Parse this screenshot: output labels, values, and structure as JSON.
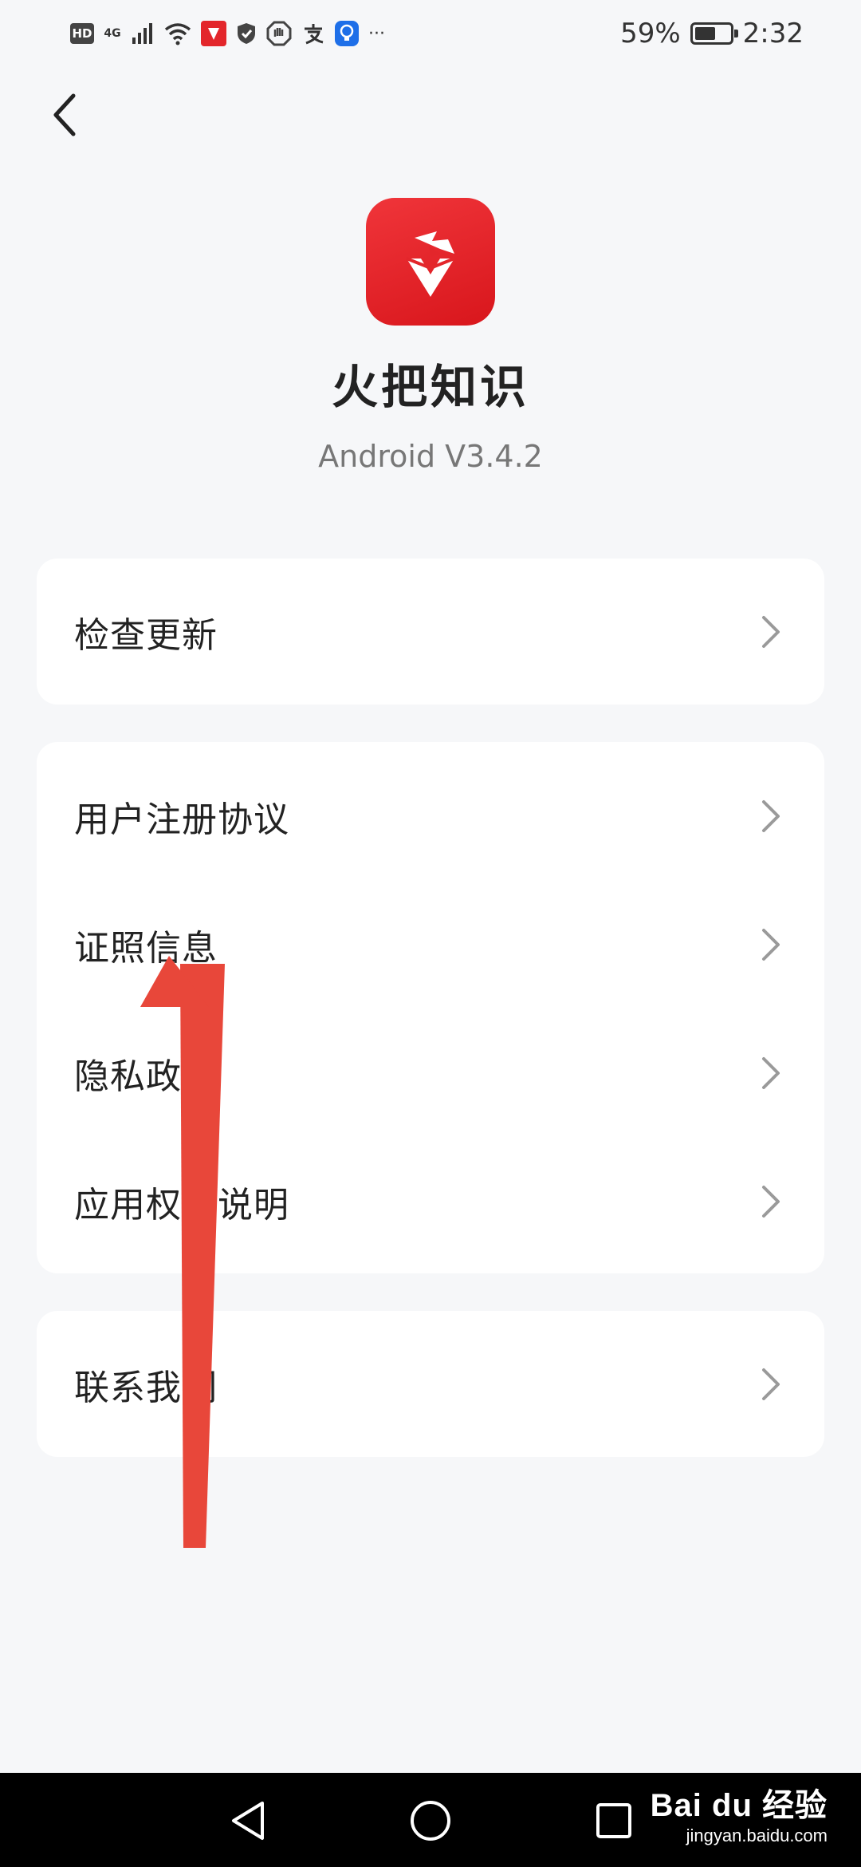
{
  "status_bar": {
    "hd_label": "HD",
    "network_label": "4G",
    "more_label": "···",
    "battery_percent_text": "59%",
    "battery_level": 0.59,
    "time": "2:32"
  },
  "app": {
    "name": "火把知识",
    "version": "Android V3.4.2",
    "brand_color": "#e3262b"
  },
  "menu": {
    "group1": [
      {
        "label": "检查更新"
      }
    ],
    "group2": [
      {
        "label": "用户注册协议"
      },
      {
        "label": "证照信息"
      },
      {
        "label": "隐私政策"
      },
      {
        "label": "应用权限说明"
      }
    ],
    "group3": [
      {
        "label": "联系我们"
      }
    ]
  },
  "annotation": {
    "arrow_color": "#e8473a"
  },
  "watermark": {
    "main": "Bai du 经验",
    "sub": "jingyan.baidu.com"
  }
}
